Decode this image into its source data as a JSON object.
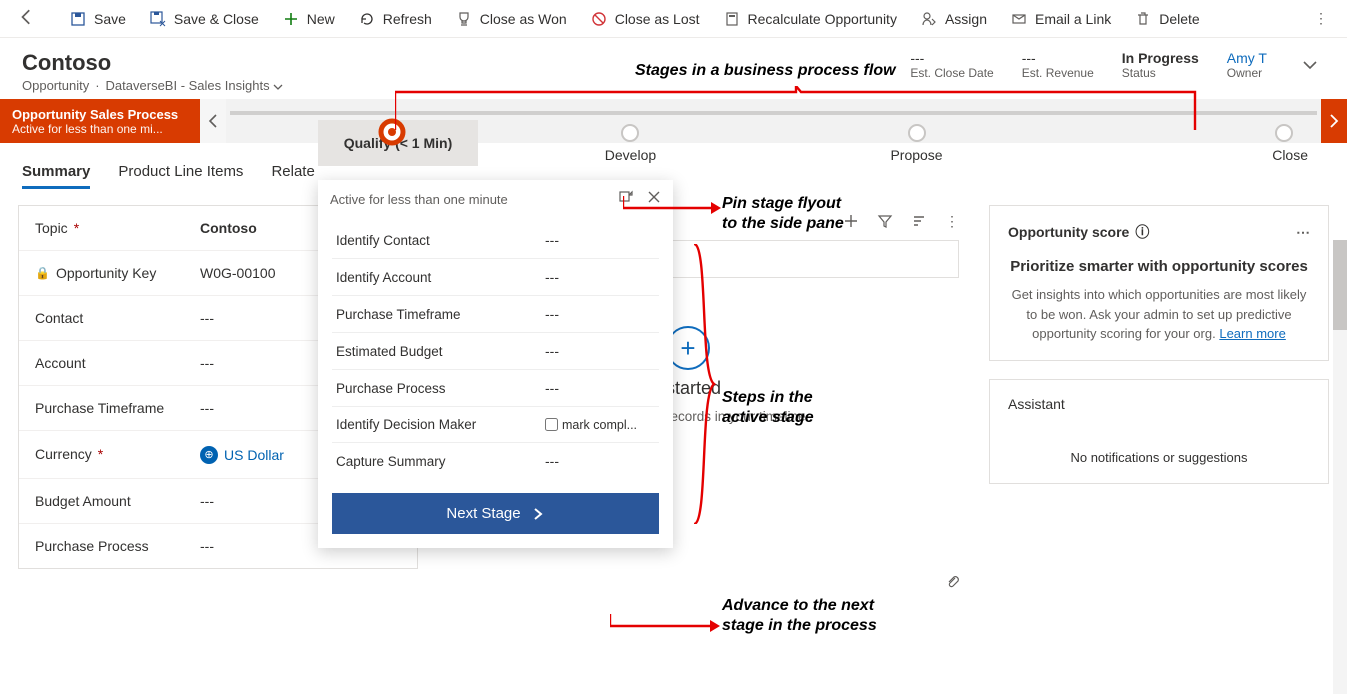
{
  "commands": {
    "save": "Save",
    "save_close": "Save & Close",
    "new": "New",
    "refresh": "Refresh",
    "close_won": "Close as Won",
    "close_lost": "Close as Lost",
    "recalc": "Recalculate Opportunity",
    "assign": "Assign",
    "email": "Email a Link",
    "delete": "Delete"
  },
  "header": {
    "title": "Contoso",
    "entity": "Opportunity",
    "view": "DataverseBI - Sales Insights",
    "est_close_value": "---",
    "est_close_label": "Est. Close Date",
    "est_rev_value": "---",
    "est_rev_label": "Est. Revenue",
    "status_value": "In Progress",
    "status_label": "Status",
    "owner_value": "Amy T",
    "owner_label": "Owner"
  },
  "bpf": {
    "process_name": "Opportunity Sales Process",
    "process_sub": "Active for less than one mi...",
    "stages": [
      "Qualify  (< 1 Min)",
      "Develop",
      "Propose",
      "Close"
    ]
  },
  "tabs": [
    "Summary",
    "Product Line Items",
    "Relate"
  ],
  "form": {
    "rows": [
      {
        "label": "Topic",
        "required": true,
        "value": "Contoso"
      },
      {
        "label": "Opportunity Key",
        "locked": true,
        "value": "W0G-00100"
      },
      {
        "label": "Contact",
        "value": "---"
      },
      {
        "label": "Account",
        "value": "---"
      },
      {
        "label": "Purchase Timeframe",
        "value": "---"
      },
      {
        "label": "Currency",
        "required": true,
        "value": "US Dollar",
        "currency": true
      },
      {
        "label": "Budget Amount",
        "value": "---"
      },
      {
        "label": "Purchase Process",
        "value": "---"
      }
    ]
  },
  "flyout": {
    "title": "Active for less than one minute",
    "steps": [
      {
        "label": "Identify Contact",
        "value": "---"
      },
      {
        "label": "Identify Account",
        "value": "---"
      },
      {
        "label": "Purchase Timeframe",
        "value": "---"
      },
      {
        "label": "Estimated Budget",
        "value": "---"
      },
      {
        "label": "Purchase Process",
        "value": "---"
      },
      {
        "label": "Identify Decision Maker",
        "value": "",
        "checkbox": "mark compl..."
      },
      {
        "label": "Capture Summary",
        "value": "---"
      }
    ],
    "next": "Next Stage"
  },
  "timeline": {
    "started": "started",
    "hint": "records in your timeline."
  },
  "score": {
    "heading": "Opportunity score",
    "title": "Prioritize smarter with opportunity scores",
    "body": "Get insights into which opportunities are most likely to be won. Ask your admin to set up predictive opportunity scoring for your org.",
    "link": "Learn more"
  },
  "assistant": {
    "heading": "Assistant",
    "empty": "No notifications or suggestions"
  },
  "annotations": {
    "a1": "Stages in a business process flow",
    "a2": "Pin stage flyout to the side pane",
    "a3": "Steps in the active stage",
    "a4": "Advance to the next stage in the process"
  }
}
